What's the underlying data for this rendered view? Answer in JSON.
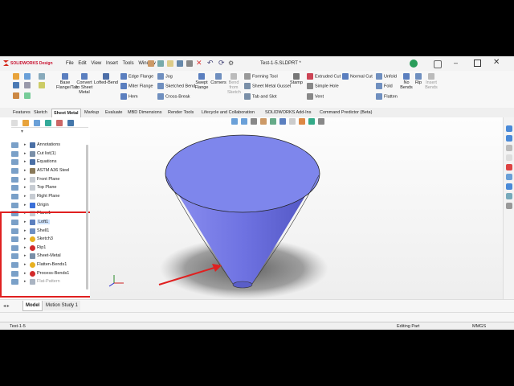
{
  "app": {
    "brand": "SOLIDWORKS Design",
    "title": "Test-1-5.SLDPRT *",
    "menu": [
      "File",
      "Edit",
      "View",
      "Insert",
      "Tools",
      "Window"
    ]
  },
  "command_manager": {
    "base_flange_tab": "Base\nFlange/Tab",
    "convert_to_sheet_metal": "Convert\nto Sheet\nMetal",
    "lofted_bend": "Lofted-Bend",
    "edge_flange": "Edge Flange",
    "jog": "Jog",
    "miter_flange": "Miter Flange",
    "sketched_bend": "Sketched Bend",
    "hem": "Hem",
    "cross_break": "Cross-Break",
    "swept_flange": "Swept\nFlange",
    "corners": "Corners",
    "bend_from_sketch": "Bend\nfrom\nSketch",
    "forming_tool": "Forming Tool",
    "sheet_metal_gusset": "Sheet Metal Gusset",
    "stamp": "Stamp",
    "tab_and_slot": "Tab and Slot",
    "extruded_cut": "Extruded Cut",
    "normal_cut": "Normal Cut",
    "simple_hole": "Simple Hole",
    "vent": "Vent",
    "unfold": "Unfold",
    "fold": "Fold",
    "flatten": "Flatten",
    "no_bends": "No\nBends",
    "rip": "Rip",
    "insert_bends": "Insert\nBends"
  },
  "tabs": [
    "Features",
    "Sketch",
    "Sheet Metal",
    "Markup",
    "Evaluate",
    "MBD Dimensions",
    "Render Tools",
    "Lifecycle and Collaboration",
    "SOLIDWORKS Add-Ins",
    "Command Predictor (Beta)"
  ],
  "active_tab": "Sheet Metal",
  "feature_tree": [
    {
      "label": "Annotations",
      "icon": "annotations-icon",
      "color": "#4a6fa5"
    },
    {
      "label": "Cut list(1)",
      "icon": "cut-list-icon",
      "color": "#7a8fa8"
    },
    {
      "label": "Equations",
      "icon": "equations-icon",
      "color": "#4a6fa5"
    },
    {
      "label": "ASTM A36 Steel",
      "icon": "material-icon",
      "color": "#8a7a5a"
    },
    {
      "label": "Front Plane",
      "icon": "plane-icon",
      "color": "#c7ccd3"
    },
    {
      "label": "Top Plane",
      "icon": "plane-icon",
      "color": "#c7ccd3"
    },
    {
      "label": "Right Plane",
      "icon": "plane-icon",
      "color": "#c7ccd3"
    },
    {
      "label": "Origin",
      "icon": "origin-icon",
      "color": "#3a6fd8"
    },
    {
      "label": "Plane1",
      "icon": "plane-icon",
      "color": "#c7ccd3"
    },
    {
      "label": "Loft1",
      "icon": "loft-icon",
      "color": "#5b7fbf"
    },
    {
      "label": "Shell1",
      "icon": "shell-icon",
      "color": "#6e8fc2"
    },
    {
      "label": "Sketch3",
      "icon": "warning-icon",
      "color": "#e8b020"
    },
    {
      "label": "Rip1",
      "icon": "error-icon",
      "color": "#d22a2a"
    },
    {
      "label": "Sheet-Metal",
      "icon": "sheet-metal-icon",
      "color": "#7a8fa8"
    },
    {
      "label": "Flatten-Bends1",
      "icon": "warning-icon",
      "color": "#e8b020"
    },
    {
      "label": "Process-Bends1",
      "icon": "error-icon",
      "color": "#d22a2a"
    },
    {
      "label": "Flat-Pattern",
      "icon": "flat-pattern-icon",
      "color": "#aab4c2"
    }
  ],
  "bottom_tabs": [
    "Model",
    "Motion Study 1"
  ],
  "status": {
    "doc": "Test-1-5",
    "mode": "Editing Part",
    "units": "MMGS"
  },
  "colors": {
    "cone_rim": "#7e86ec",
    "cone_body": "#6f73e2",
    "highlight_box": "#e02020",
    "arrow": "#e02020",
    "loft_selection": "#cfe3ff"
  }
}
